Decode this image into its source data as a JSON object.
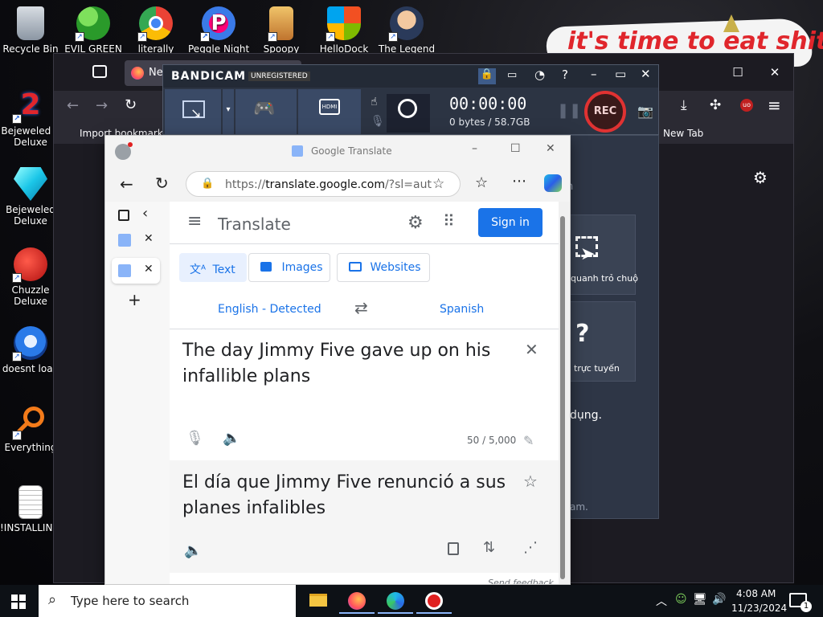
{
  "desktop": {
    "wallpaper_caption": "it's time to eat shit",
    "icons_top": [
      {
        "label": "Recycle Bin",
        "icon": "recycle-bin-icon"
      },
      {
        "label": "EVIL GREEN",
        "icon": "people-icon"
      },
      {
        "label": "literally",
        "icon": "chrome-icon"
      },
      {
        "label": "Peggle Nights",
        "icon": "peggle-icon"
      },
      {
        "label": "Spoopy",
        "icon": "spoopy-icon"
      },
      {
        "label": "HelloDock",
        "icon": "windows-shield-icon"
      },
      {
        "label": "The Legend",
        "icon": "legend-icon"
      }
    ],
    "icons_left": [
      {
        "label": "Bejeweled 2 Deluxe",
        "line1": "Bejeweled 2",
        "line2": "Deluxe"
      },
      {
        "label": "Bejeweled Deluxe",
        "line1": "Bejeweled",
        "line2": "Deluxe"
      },
      {
        "label": "Chuzzle Deluxe",
        "line1": "Chuzzle",
        "line2": "Deluxe"
      },
      {
        "label": "doesnt load",
        "line1": "doesnt load",
        "line2": ""
      },
      {
        "label": "Everything",
        "line1": "Everything",
        "line2": ""
      },
      {
        "label": "!INSTALLIN...",
        "line1": "!INSTALLIN...",
        "line2": ""
      }
    ]
  },
  "firefox": {
    "tab_title": "Ne",
    "bookmark_label": "Import bookmarks...",
    "newtab_label": "New Tab",
    "partial_text_1": "quanh trỏ chuộ",
    "partial_text_2": "trực tuyến",
    "partial_text_3": "dụng.",
    "partial_text_4": "am.",
    "partial_text_5": "n"
  },
  "bandicam": {
    "brand": "BANDICAM",
    "status": "UNREGISTERED",
    "timer": "00:00:00",
    "size": "0 bytes / 58.7GB",
    "rec_label": "REC",
    "hdmi_label": "HDMI"
  },
  "edge": {
    "title": "Google Translate",
    "url_prefix": "https://",
    "url_domain": "translate.google.com",
    "url_rest": "/?sl=aut..."
  },
  "translate": {
    "app_title": "Translate",
    "sign_in": "Sign in",
    "modes": [
      "Text",
      "Images",
      "Websites"
    ],
    "source_lang": "English - Detected",
    "target_lang": "Spanish",
    "source_text": "The day Jimmy Five gave up on his infallible plans",
    "char_count": "50 / 5,000",
    "translated_text": "El día que Jimmy Five renunció a sus planes infalibles",
    "feedback": "Send feedback"
  },
  "taskbar": {
    "search_placeholder": "Type here to search",
    "time": "4:08 AM",
    "date": "11/23/2024",
    "notification_count": "1"
  }
}
